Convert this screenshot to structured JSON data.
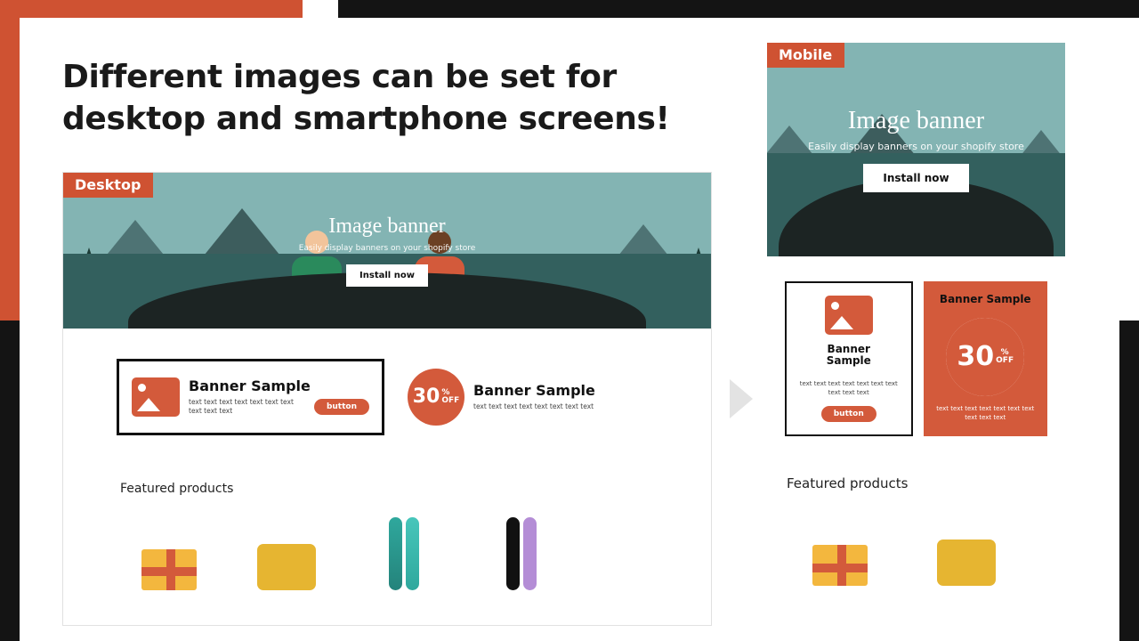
{
  "headline": "Different images can be set for desktop and smartphone screens!",
  "tags": {
    "desktop": "Desktop",
    "mobile": "Mobile"
  },
  "hero": {
    "title": "Image banner",
    "subtitle": "Easily display banners on your shopify store",
    "button": "Install now"
  },
  "banners": {
    "a": {
      "title": "Banner Sample",
      "body": "text text text text text text text text text text",
      "button": "button"
    },
    "b": {
      "percent": "30",
      "pct_sign": "%",
      "off": "OFF",
      "title": "Banner Sample",
      "body": "text text text text text text text text"
    },
    "mobile_a": {
      "title_l1": "Banner",
      "title_l2": "Sample",
      "body": "text text text text text text text text text text",
      "button": "button"
    },
    "mobile_b": {
      "title": "Banner Sample",
      "percent": "30",
      "pct_sign": "%",
      "off": "OFF",
      "body": "text text text text text text text text text text"
    }
  },
  "section": {
    "featured": "Featured products"
  }
}
